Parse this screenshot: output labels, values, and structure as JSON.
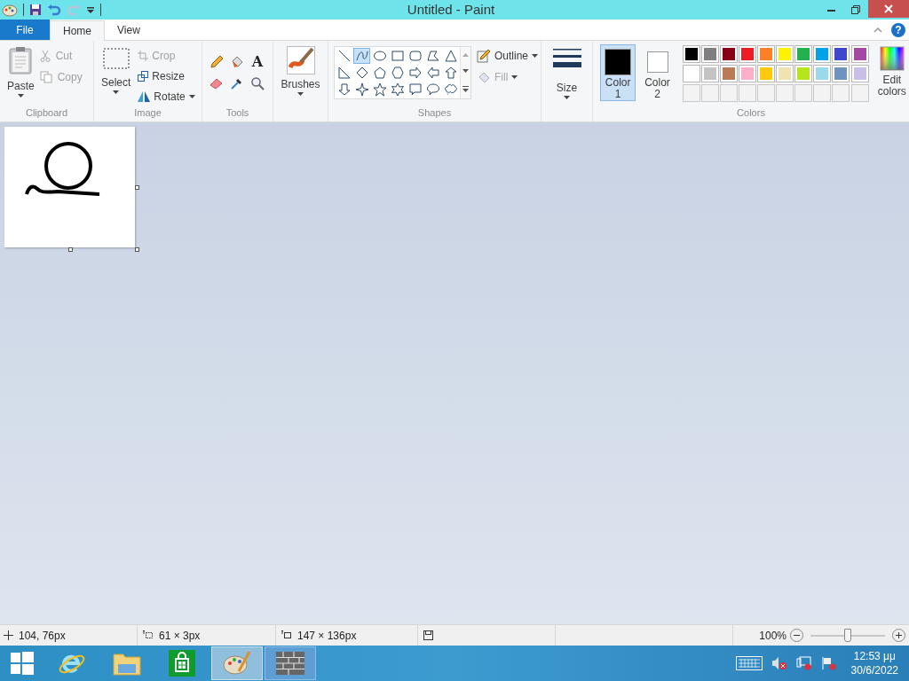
{
  "window": {
    "title": "Untitled - Paint"
  },
  "tabs": [
    {
      "label": "File",
      "kind": "file",
      "selected": false
    },
    {
      "label": "Home",
      "kind": "tab",
      "selected": true
    },
    {
      "label": "View",
      "kind": "tab",
      "selected": false
    }
  ],
  "clipboard": {
    "paste": "Paste",
    "cut": "Cut",
    "copy": "Copy",
    "label": "Clipboard"
  },
  "image": {
    "select": "Select",
    "crop": "Crop",
    "resize": "Resize",
    "rotate": "Rotate",
    "label": "Image"
  },
  "tools": {
    "label": "Tools",
    "text_tool": "A"
  },
  "help": "?",
  "brushes": {
    "label": "Brushes"
  },
  "shapes": {
    "label": "Shapes",
    "outline": "Outline",
    "fill": "Fill",
    "items": [
      {
        "kind": "line",
        "selected": false
      },
      {
        "kind": "curve",
        "selected": true
      },
      {
        "kind": "oval",
        "selected": false
      },
      {
        "kind": "rect",
        "selected": false
      },
      {
        "kind": "roundrect",
        "selected": false
      },
      {
        "kind": "polygon",
        "selected": false
      },
      {
        "kind": "triangle",
        "selected": false
      },
      {
        "kind": "righttriangle",
        "selected": false
      },
      {
        "kind": "diamond",
        "selected": false
      },
      {
        "kind": "pentagon",
        "selected": false
      },
      {
        "kind": "hexagon",
        "selected": false
      },
      {
        "kind": "arrowright",
        "selected": false
      },
      {
        "kind": "arrowleft",
        "selected": false
      },
      {
        "kind": "arrowup",
        "selected": false
      },
      {
        "kind": "arrowdown",
        "selected": false
      },
      {
        "kind": "star4",
        "selected": false
      },
      {
        "kind": "star5",
        "selected": false
      },
      {
        "kind": "star6",
        "selected": false
      },
      {
        "kind": "calloutrect",
        "selected": false
      },
      {
        "kind": "calloutoval",
        "selected": false
      },
      {
        "kind": "calloutcloud",
        "selected": false
      }
    ]
  },
  "size": {
    "label": "Size"
  },
  "colors": {
    "label": "Colors",
    "edit": "Edit colors",
    "slots": [
      {
        "label": "Color",
        "number": "1",
        "color": "#000000",
        "selected": true
      },
      {
        "label": "Color",
        "number": "2",
        "color": "#ffffff",
        "selected": false
      }
    ],
    "palette": [
      {
        "color": "#000000"
      },
      {
        "color": "#7f7f7f"
      },
      {
        "color": "#880015"
      },
      {
        "color": "#ed1c24"
      },
      {
        "color": "#ff7f27"
      },
      {
        "color": "#fff200"
      },
      {
        "color": "#22b14c"
      },
      {
        "color": "#00a2e8"
      },
      {
        "color": "#3f48cc"
      },
      {
        "color": "#a349a4"
      },
      {
        "color": "#ffffff"
      },
      {
        "color": "#c3c3c3"
      },
      {
        "color": "#b97a57"
      },
      {
        "color": "#ffaec9"
      },
      {
        "color": "#ffc90e"
      },
      {
        "color": "#efe4b0"
      },
      {
        "color": "#b5e61d"
      },
      {
        "color": "#99d9ea"
      },
      {
        "color": "#7092be"
      },
      {
        "color": "#c8bfe7"
      }
    ]
  },
  "status_bar": {
    "position": "104, 76px",
    "selection": "61 × 3px",
    "canvas_size": "147 × 136px",
    "zoom": "100%",
    "level": 0.5
  },
  "taskbar": {
    "time": "12:53 μμ",
    "date": "30/6/2022"
  }
}
